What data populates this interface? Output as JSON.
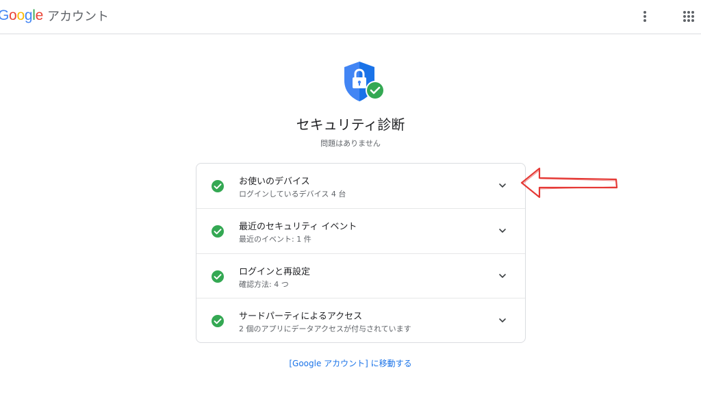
{
  "header": {
    "logo_letters": [
      {
        "char": "o",
        "color": "#ea4335"
      },
      {
        "char": "o",
        "color": "#fbbc05"
      },
      {
        "char": "g",
        "color": "#4285f4"
      },
      {
        "char": "l",
        "color": "#34a853"
      },
      {
        "char": "e",
        "color": "#ea4335"
      }
    ],
    "logo_first_letter": {
      "char": "G",
      "color": "#4285f4"
    },
    "brand_suffix": "アカウント",
    "more_icon": "more-vert-icon",
    "apps_icon": "apps-grid-icon"
  },
  "hero": {
    "icon": "shield-lock-check-icon",
    "title": "セキュリティ診断",
    "subtitle": "問題はありません"
  },
  "checkups": [
    {
      "title": "お使いのデバイス",
      "subtitle": "ログインしているデバイス 4 台"
    },
    {
      "title": "最近のセキュリティ イベント",
      "subtitle": "最近のイベント: 1 件"
    },
    {
      "title": "ログインと再設定",
      "subtitle": "確認方法: 4 つ"
    },
    {
      "title": "サードパーティによるアクセス",
      "subtitle": "2 個のアプリにデータアクセスが付与されています"
    }
  ],
  "footer": {
    "link_label": "[Google アカウント] に移動する"
  },
  "colors": {
    "accent_blue": "#1a73e8",
    "check_green": "#34a853",
    "shield_blue": "#4285f4",
    "annotation_red": "#e53935"
  }
}
